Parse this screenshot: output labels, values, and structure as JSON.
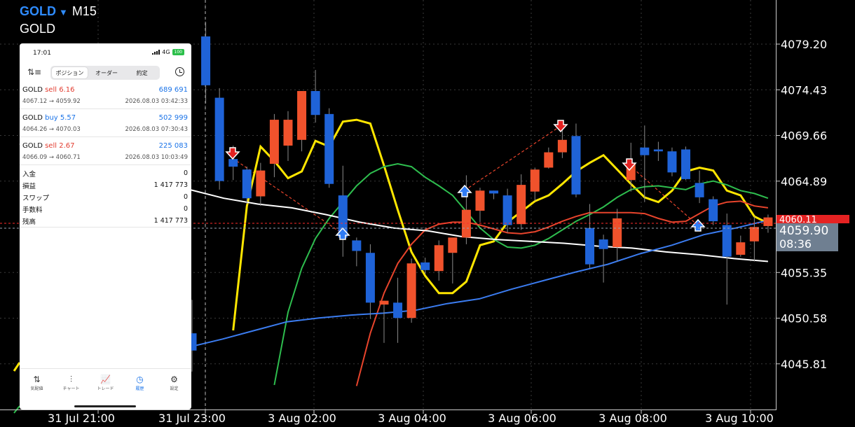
{
  "header": {
    "symbol": "GOLD",
    "timeframe": "M15",
    "name": "GOLD"
  },
  "chart_data": {
    "type": "candlestick",
    "y_ticks": [
      "4079.20",
      "4074.43",
      "4069.66",
      "4064.89",
      "4055.35",
      "4050.58",
      "4045.81"
    ],
    "x_ticks": [
      "31 Jul 21:00",
      "31 Jul 23:00",
      "3 Aug 02:00",
      "3 Aug 04:00",
      "3 Aug 06:00",
      "3 Aug 08:00",
      "3 Aug 10:00"
    ],
    "current_price": "4059.90",
    "countdown": "08:36",
    "ask_label": "4060.11",
    "colors": {
      "bull": "#f0522c",
      "bear": "#1f63d8",
      "ma_yellow": "#ffe600",
      "ma_green": "#2ebd4e",
      "ma_red": "#e8442c",
      "ma_white": "#ffffff",
      "ma_blue": "#3b7cf0"
    },
    "candles": [
      {
        "o": 4049.0,
        "h": 4052.5,
        "l": 4045.0,
        "c": 4047.2
      },
      {
        "o": 4080.0,
        "h": 4081.5,
        "l": 4073.0,
        "c": 4074.9
      },
      {
        "o": 4073.6,
        "h": 4074.6,
        "l": 4064.0,
        "c": 4064.9
      },
      {
        "o": 4067.2,
        "h": 4068.6,
        "l": 4065.0,
        "c": 4066.4
      },
      {
        "o": 4066.1,
        "h": 4066.4,
        "l": 4062.5,
        "c": 4063.1
      },
      {
        "o": 4063.3,
        "h": 4066.8,
        "l": 4062.3,
        "c": 4066.0
      },
      {
        "o": 4066.7,
        "h": 4071.9,
        "l": 4065.3,
        "c": 4071.3
      },
      {
        "o": 4068.6,
        "h": 4072.2,
        "l": 4067.0,
        "c": 4071.3
      },
      {
        "o": 4069.2,
        "h": 4074.3,
        "l": 4068.0,
        "c": 4074.3
      },
      {
        "o": 4074.3,
        "h": 4076.5,
        "l": 4071.0,
        "c": 4071.8
      },
      {
        "o": 4071.9,
        "h": 4072.5,
        "l": 4064.2,
        "c": 4064.6
      },
      {
        "o": 4063.4,
        "h": 4066.5,
        "l": 4057.0,
        "c": 4059.0
      },
      {
        "o": 4058.7,
        "h": 4059.0,
        "l": 4056.0,
        "c": 4057.6
      },
      {
        "o": 4057.4,
        "h": 4058.3,
        "l": 4050.5,
        "c": 4052.2
      },
      {
        "o": 4052.0,
        "h": 4052.4,
        "l": 4048.0,
        "c": 4052.4
      },
      {
        "o": 4052.2,
        "h": 4054.8,
        "l": 4048.0,
        "c": 4050.6
      },
      {
        "o": 4050.6,
        "h": 4056.8,
        "l": 4050.1,
        "c": 4056.3
      },
      {
        "o": 4056.4,
        "h": 4056.9,
        "l": 4055.2,
        "c": 4055.6
      },
      {
        "o": 4055.5,
        "h": 4058.7,
        "l": 4054.5,
        "c": 4058.2
      },
      {
        "o": 4057.4,
        "h": 4058.9,
        "l": 4054.2,
        "c": 4059.0
      },
      {
        "o": 4059.0,
        "h": 4065.5,
        "l": 4058.3,
        "c": 4061.9
      },
      {
        "o": 4061.8,
        "h": 4064.2,
        "l": 4060.6,
        "c": 4063.9
      },
      {
        "o": 4063.9,
        "h": 4063.9,
        "l": 4063.0,
        "c": 4063.6
      },
      {
        "o": 4063.4,
        "h": 4064.1,
        "l": 4059.5,
        "c": 4060.3
      },
      {
        "o": 4060.4,
        "h": 4065.6,
        "l": 4059.8,
        "c": 4064.5
      },
      {
        "o": 4063.8,
        "h": 4066.3,
        "l": 4062.8,
        "c": 4066.1
      },
      {
        "o": 4066.3,
        "h": 4068.4,
        "l": 4066.2,
        "c": 4067.9
      },
      {
        "o": 4067.9,
        "h": 4070.4,
        "l": 4067.3,
        "c": 4069.2
      },
      {
        "o": 4069.6,
        "h": 4070.9,
        "l": 4063.2,
        "c": 4063.5
      },
      {
        "o": 4060.0,
        "h": 4062.5,
        "l": 4055.8,
        "c": 4056.2
      },
      {
        "o": 4058.8,
        "h": 4059.3,
        "l": 4054.3,
        "c": 4057.8
      },
      {
        "o": 4058.0,
        "h": 4062.0,
        "l": 4056.5,
        "c": 4061.0
      },
      {
        "o": 4065.0,
        "h": 4068.9,
        "l": 4063.8,
        "c": 4066.8
      },
      {
        "o": 4068.4,
        "h": 4070.7,
        "l": 4062.7,
        "c": 4067.6
      },
      {
        "o": 4068.2,
        "h": 4069.0,
        "l": 4067.0,
        "c": 4068.0
      },
      {
        "o": 4068.0,
        "h": 4068.4,
        "l": 4065.4,
        "c": 4065.8
      },
      {
        "o": 4068.2,
        "h": 4068.5,
        "l": 4065.0,
        "c": 4065.1
      },
      {
        "o": 4064.7,
        "h": 4066.0,
        "l": 4062.6,
        "c": 4063.2
      },
      {
        "o": 4063.0,
        "h": 4063.3,
        "l": 4060.3,
        "c": 4060.7
      },
      {
        "o": 4060.3,
        "h": 4061.5,
        "l": 4052.0,
        "c": 4057.0
      },
      {
        "o": 4057.2,
        "h": 4059.2,
        "l": 4057.0,
        "c": 4058.5
      },
      {
        "o": 4058.6,
        "h": 4061.2,
        "l": 4056.5,
        "c": 4060.1
      },
      {
        "o": 4060.2,
        "h": 4061.4,
        "l": 4059.5,
        "c": 4061.1
      }
    ],
    "moving_averages": [
      {
        "color": "ma_yellow",
        "values": [
          4049.3,
          4062.3,
          4068.5,
          4067.0,
          4065.2,
          4065.9,
          4069.1,
          4068.5,
          4071.1,
          4071.3,
          4070.9,
          4066.5,
          4061.9,
          4057.5,
          4055.0,
          4053.2,
          4053.2,
          4054.4,
          4058.2,
          4058.6,
          4060.6,
          4061.7,
          4062.8,
          4063.4,
          4064.6,
          4065.9,
          4066.8,
          4067.6,
          4066.1,
          4064.6,
          4063.2,
          4062.7,
          4063.9,
          4065.9,
          4066.3,
          4066.0,
          4063.9,
          4063.4,
          4061.2,
          4060.5
        ]
      },
      {
        "color": "ma_green",
        "values": [
          4043.6,
          4051.2,
          4055.8,
          4058.9,
          4061.0,
          4062.7,
          4064.4,
          4065.7,
          4066.4,
          4066.7,
          4066.4,
          4065.3,
          4064.4,
          4063.4,
          4061.7,
          4060.0,
          4058.8,
          4058.0,
          4057.9,
          4058.2,
          4058.9,
          4059.8,
          4060.7,
          4061.4,
          4062.2,
          4063.2,
          4064.0,
          4064.3,
          4064.4,
          4064.2,
          4064.0,
          4064.6,
          4064.9,
          4064.5,
          4063.9,
          4063.6,
          4063.1
        ]
      },
      {
        "color": "ma_red",
        "values": [
          4043.5,
          4049.0,
          4053.2,
          4056.3,
          4058.3,
          4059.8,
          4060.4,
          4060.6,
          4060.6,
          4060.3,
          4059.9,
          4059.5,
          4059.4,
          4059.6,
          4060.1,
          4060.7,
          4061.2,
          4061.6,
          4061.6,
          4061.6,
          4061.6,
          4061.5,
          4061.0,
          4060.6,
          4060.7,
          4061.5,
          4062.3,
          4062.7,
          4062.8,
          4062.3,
          4062.1
        ]
      },
      {
        "color": "ma_white",
        "values": [
          4068.8,
          4067.4,
          4066.3,
          4065.2,
          4064.6,
          4064.0,
          4063.1,
          4062.5,
          4062.1,
          4061.4,
          4060.6,
          4060.0,
          4059.7,
          4059.1,
          4058.8,
          4058.6,
          4058.4,
          4058.1,
          4057.9,
          4057.5,
          4057.2,
          4056.8,
          4056.5
        ]
      },
      {
        "color": "ma_blue",
        "values": [
          4047.6,
          4048.4,
          4049.3,
          4050.2,
          4050.6,
          4050.9,
          4051.1,
          4051.4,
          4052.1,
          4052.6,
          4053.6,
          4054.5,
          4055.4,
          4056.2,
          4057.3,
          4058.2,
          4059.3,
          4060.0,
          4060.8
        ]
      }
    ]
  },
  "phone": {
    "time": "17:01",
    "network": "4G",
    "battery": "100",
    "tabs": [
      "ポジション",
      "オーダー",
      "約定"
    ],
    "trades": [
      {
        "symbol": "GOLD",
        "side": "sell",
        "volume": "6.16",
        "profit": "689 691",
        "prices": "4067.12 → 4059.92",
        "date": "2026.08.03 03:42:33"
      },
      {
        "symbol": "GOLD",
        "side": "buy",
        "volume": "5.57",
        "profit": "502 999",
        "prices": "4064.26 → 4070.03",
        "date": "2026.08.03 07:30:43"
      },
      {
        "symbol": "GOLD",
        "side": "sell",
        "volume": "2.67",
        "profit": "225 083",
        "prices": "4066.09 → 4060.71",
        "date": "2026.08.03 10:03:49"
      }
    ],
    "summary": [
      {
        "label": "入金",
        "value": "0"
      },
      {
        "label": "損益",
        "value": "1 417 773"
      },
      {
        "label": "スワップ",
        "value": "0"
      },
      {
        "label": "手数料",
        "value": "0"
      },
      {
        "label": "残高",
        "value": "1 417 773"
      }
    ],
    "nav": [
      {
        "label": "気配値",
        "icon": "⇅"
      },
      {
        "label": "チャート",
        "icon": "⫶"
      },
      {
        "label": "トレード",
        "icon": "📈"
      },
      {
        "label": "履歴",
        "icon": "◷"
      },
      {
        "label": "設定",
        "icon": "⚙"
      }
    ]
  }
}
